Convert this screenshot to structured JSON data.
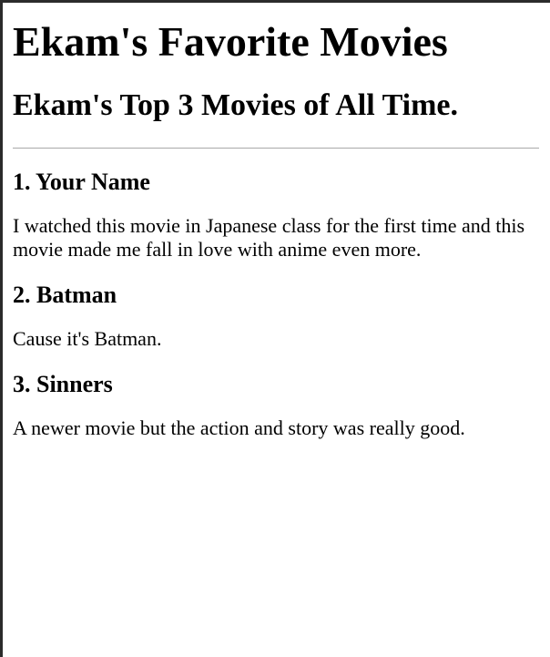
{
  "page": {
    "title": "Ekam's Favorite Movies",
    "subtitle": "Ekam's Top 3 Movies of All Time."
  },
  "movies": [
    {
      "heading": "1. Your Name",
      "description": "I watched this movie in Japanese class for the first time and this movie made me fall in love with anime even more."
    },
    {
      "heading": "2. Batman",
      "description": "Cause it's Batman."
    },
    {
      "heading": "3. Sinners",
      "description": "A newer movie but the action and story was really good."
    }
  ]
}
